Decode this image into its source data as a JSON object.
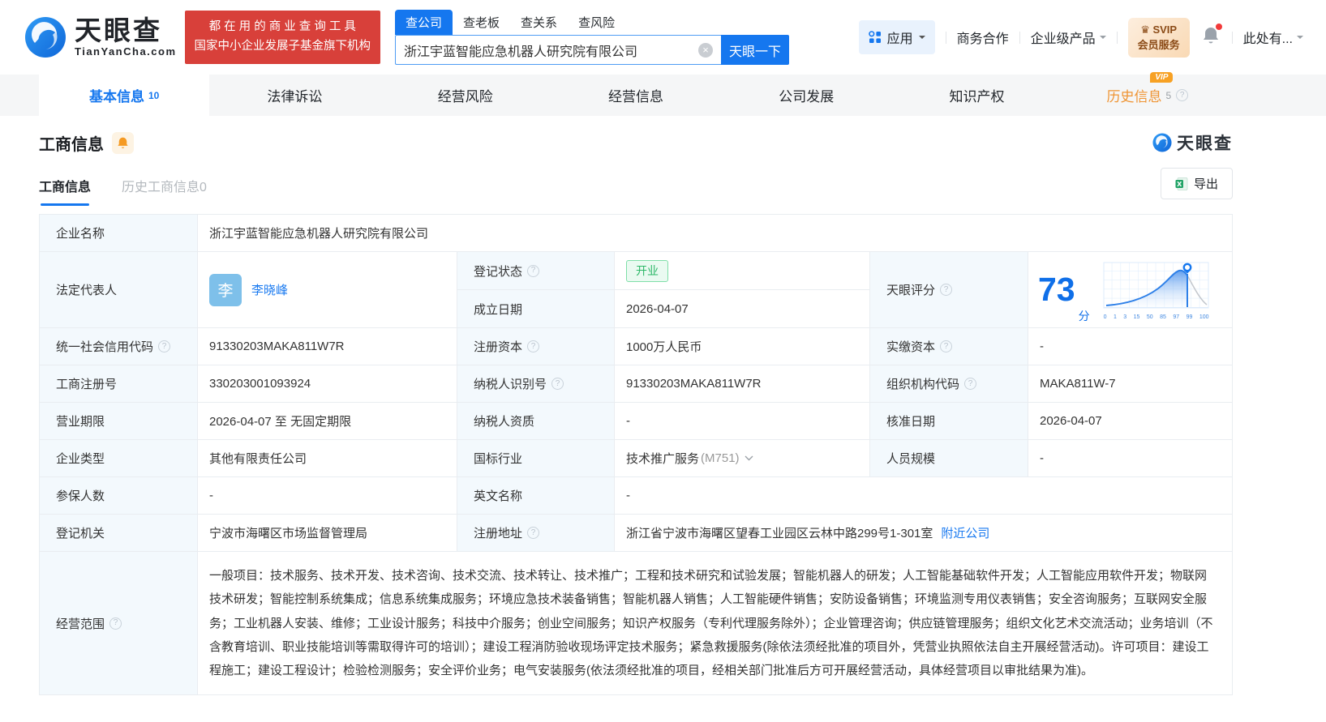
{
  "colors": {
    "accent": "#1577ef",
    "banner_red": "#d8403a",
    "open_green": "#2cb767",
    "vip_orange": "#f7a124",
    "score_blue": "#0f6fe8"
  },
  "icons": {
    "help": "?",
    "clear": "×",
    "crown": "♛"
  },
  "header": {
    "logo": {
      "title": "天眼查",
      "subtitle": "TianYanCha.com"
    },
    "banner": {
      "line1": "都 在 用 的 商 业 查 询 工 具",
      "line2": "国家中小企业发展子基金旗下机构"
    },
    "search": {
      "tabs": [
        {
          "label": "查公司"
        },
        {
          "label": "查老板"
        },
        {
          "label": "查关系"
        },
        {
          "label": "查风险"
        }
      ],
      "value": "浙江宇蓝智能应急机器人研究院有限公司",
      "button": "天眼一下"
    },
    "menu": {
      "apps": "应用",
      "cooperation": "商务合作",
      "enterprise": "企业级产品",
      "svip_line1": "SVIP",
      "svip_line2": "会员服务",
      "user": "此处有..."
    }
  },
  "nav": {
    "tabs": [
      {
        "label": "基本信息",
        "count": "10"
      },
      {
        "label": "法律诉讼"
      },
      {
        "label": "经营风险"
      },
      {
        "label": "经营信息"
      },
      {
        "label": "公司发展"
      },
      {
        "label": "知识产权"
      },
      {
        "label": "历史信息",
        "count": "5",
        "vip": "VIP"
      }
    ]
  },
  "section": {
    "title": "工商信息",
    "watermark": "天眼查",
    "subtabs": [
      "工商信息",
      "历史工商信息0"
    ],
    "export_label": "导出"
  },
  "score_chart": {
    "type": "area",
    "score": "73",
    "unit": "分",
    "ticks": [
      "0",
      "1",
      "3",
      "15",
      "50",
      "85",
      "97",
      "99",
      "100"
    ]
  },
  "table": {
    "company_name_label": "企业名称",
    "company_name": "浙江宇蓝智能应急机器人研究院有限公司",
    "legal_rep_label": "法定代表人",
    "legal_rep_avatar": "李",
    "legal_rep_name": "李晓峰",
    "reg_status_label": "登记状态",
    "reg_status": "开业",
    "establish_date_label": "成立日期",
    "establish_date": "2026-04-07",
    "score_label": "天眼评分",
    "credit_code_label": "统一社会信用代码",
    "credit_code": "91330203MAKA811W7R",
    "reg_capital_label": "注册资本",
    "reg_capital": "1000万人民币",
    "paid_capital_label": "实缴资本",
    "paid_capital": "-",
    "reg_number_label": "工商注册号",
    "reg_number": "330203001093924",
    "taxpayer_id_label": "纳税人识别号",
    "taxpayer_id": "91330203MAKA811W7R",
    "org_code_label": "组织机构代码",
    "org_code": "MAKA811W-7",
    "business_term_label": "营业期限",
    "business_term": "2026-04-07 至 无固定期限",
    "taxpayer_quality_label": "纳税人资质",
    "taxpayer_quality": "-",
    "approval_date_label": "核准日期",
    "approval_date": "2026-04-07",
    "company_type_label": "企业类型",
    "company_type": "其他有限责任公司",
    "industry_label": "国标行业",
    "industry": "技术推广服务",
    "industry_code": "(M751)",
    "staff_size_label": "人员规模",
    "staff_size": "-",
    "insured_label": "参保人数",
    "insured": "-",
    "english_name_label": "英文名称",
    "english_name": "-",
    "reg_authority_label": "登记机关",
    "reg_authority": "宁波市海曙区市场监督管理局",
    "reg_address_label": "注册地址",
    "reg_address": "浙江省宁波市海曙区望春工业园区云林中路299号1-301室",
    "nearby_link": "附近公司",
    "business_scope_label": "经营范围",
    "business_scope": "一般项目：技术服务、技术开发、技术咨询、技术交流、技术转让、技术推广；工程和技术研究和试验发展；智能机器人的研发；人工智能基础软件开发；人工智能应用软件开发；物联网技术研发；智能控制系统集成；信息系统集成服务；环境应急技术装备销售；智能机器人销售；人工智能硬件销售；安防设备销售；环境监测专用仪表销售；安全咨询服务；互联网安全服务；工业机器人安装、维修；工业设计服务；科技中介服务；创业空间服务；知识产权服务（专利代理服务除外）；企业管理咨询；供应链管理服务；组织文化艺术交流活动；业务培训（不含教育培训、职业技能培训等需取得许可的培训）；建设工程消防验收现场评定技术服务；紧急救援服务(除依法须经批准的项目外，凭营业执照依法自主开展经营活动)。许可项目：建设工程施工；建设工程设计；检验检测服务；安全评价业务；电气安装服务(依法须经批准的项目，经相关部门批准后方可开展经营活动，具体经营项目以审批结果为准)。"
  }
}
